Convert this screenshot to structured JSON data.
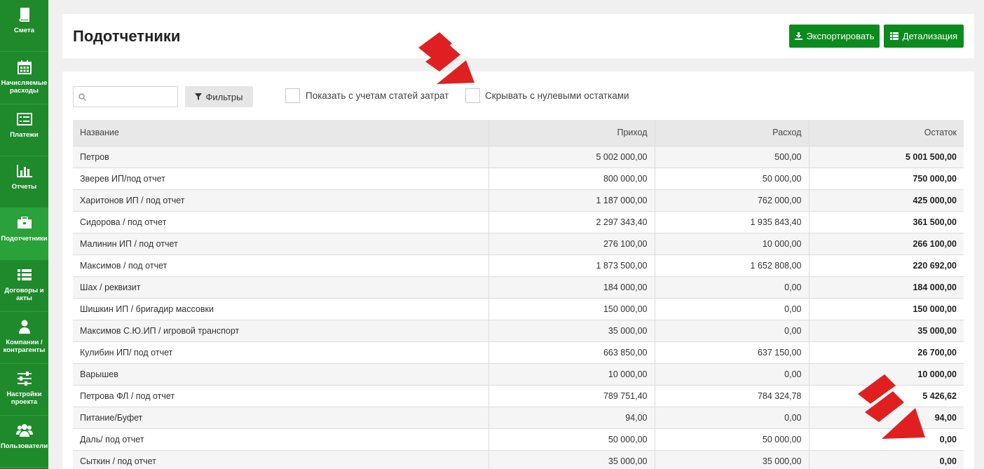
{
  "sidebar": {
    "items": [
      {
        "label": "Смета",
        "icon": "book-icon"
      },
      {
        "label": "Начисляемые расходы",
        "icon": "calendar-icon"
      },
      {
        "label": "Платежи",
        "icon": "list-card-icon"
      },
      {
        "label": "Отчеты",
        "icon": "bar-chart-icon"
      },
      {
        "label": "Подотчетники",
        "icon": "briefcase-icon",
        "active": true
      },
      {
        "label": "Договоры и акты",
        "icon": "list-icon"
      },
      {
        "label": "Компании / контрагенты",
        "icon": "user-icon"
      },
      {
        "label": "Настройки проекта",
        "icon": "sliders-icon"
      },
      {
        "label": "Пользователи",
        "icon": "users-icon"
      }
    ]
  },
  "header": {
    "title": "Подотчетники",
    "export_label": "Экспортировать",
    "details_label": "Детализация"
  },
  "filters": {
    "search_placeholder": "",
    "filter_button": "Фильтры",
    "show_cost_items_label": "Показать с учетам статей затрат",
    "hide_zero_label": "Скрывать с нулевыми остатками"
  },
  "table": {
    "headers": [
      "Название",
      "Приход",
      "Расход",
      "Остаток"
    ],
    "rows": [
      [
        "Петров",
        "5 002 000,00",
        "500,00",
        "5 001 500,00"
      ],
      [
        "Зверев ИП/под отчет",
        "800 000,00",
        "50 000,00",
        "750 000,00"
      ],
      [
        "Харитонов ИП / под отчет",
        "1 187 000,00",
        "762 000,00",
        "425 000,00"
      ],
      [
        "Сидорова / под отчет",
        "2 297 343,40",
        "1 935 843,40",
        "361 500,00"
      ],
      [
        "Малинин ИП / под отчет",
        "276 100,00",
        "10 000,00",
        "266 100,00"
      ],
      [
        "Максимов / под отчет",
        "1 873 500,00",
        "1 652 808,00",
        "220 692,00"
      ],
      [
        "Шах / реквизит",
        "184 000,00",
        "0,00",
        "184 000,00"
      ],
      [
        "Шишкин ИП / бригадир массовки",
        "150 000,00",
        "0,00",
        "150 000,00"
      ],
      [
        "Максимов С.Ю.ИП / игровой транспорт",
        "35 000,00",
        "0,00",
        "35 000,00"
      ],
      [
        "Кулибин ИП/ под отчет",
        "663 850,00",
        "637 150,00",
        "26 700,00"
      ],
      [
        "Варышев",
        "10 000,00",
        "0,00",
        "10 000,00"
      ],
      [
        "Петрова ФЛ / под отчет",
        "789 751,40",
        "784 324,78",
        "5 426,62"
      ],
      [
        "Питание/Буфет",
        "94,00",
        "0,00",
        "94,00"
      ],
      [
        "Даль/ под отчет",
        "50 000,00",
        "50 000,00",
        "0,00"
      ],
      [
        "Сыткин / под отчет",
        "35 000,00",
        "35 000,00",
        "0,00"
      ]
    ]
  },
  "colors": {
    "sidebar": "#1f8a2c",
    "button": "#0b8a1e",
    "annotation_arrow": "#e02020"
  }
}
